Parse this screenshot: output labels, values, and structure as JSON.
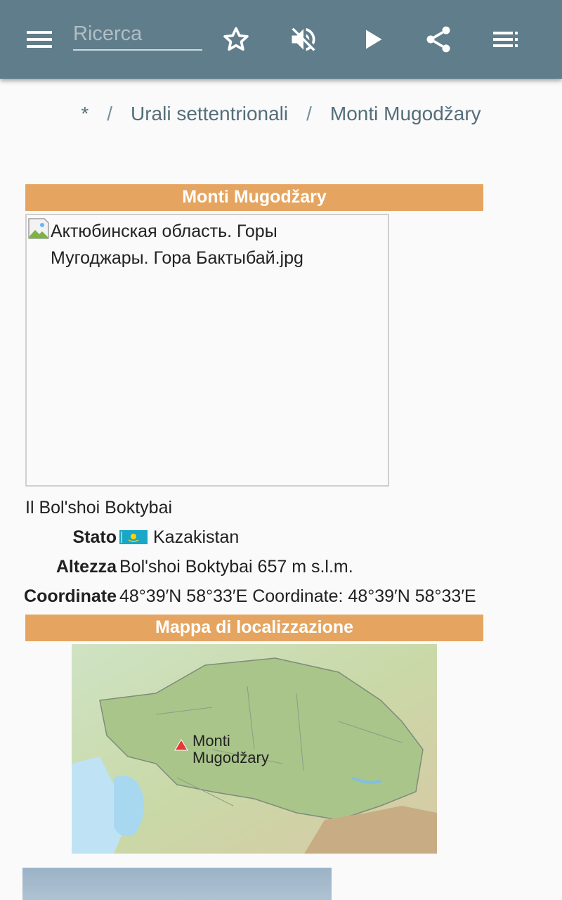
{
  "appbar": {
    "search_placeholder": "Ricerca",
    "icons": [
      "menu-icon",
      "star-icon",
      "volume-off-icon",
      "play-icon",
      "share-icon",
      "playlist-icon"
    ]
  },
  "breadcrumb": {
    "items": [
      "*",
      "Urali settentrionali",
      "Monti Mugodžary"
    ],
    "separator": "/"
  },
  "infobox": {
    "title": "Monti Mugodžary",
    "image_alt": "Актюбинская область. Горы Мугоджары. Гора Бактыбай.jpg",
    "caption": "Il Bol'shoi Boktybai",
    "rows": [
      {
        "label": "Stato",
        "value": "Kazakistan"
      },
      {
        "label": "Altezza",
        "value": "Bol'shoi Boktybai  657 m s.l.m."
      },
      {
        "label": "Coordinate",
        "value": "48°39′N 58°33′E Coordinate: 48°39′N 58°33′E"
      }
    ],
    "map_header": "Mappa di localizzazione",
    "map_label_line1": "Monti",
    "map_label_line2": "Mugodžary"
  },
  "colors": {
    "appbar": "#607d8b",
    "header": "#e5a560",
    "breadcrumb": "#546e7a"
  }
}
